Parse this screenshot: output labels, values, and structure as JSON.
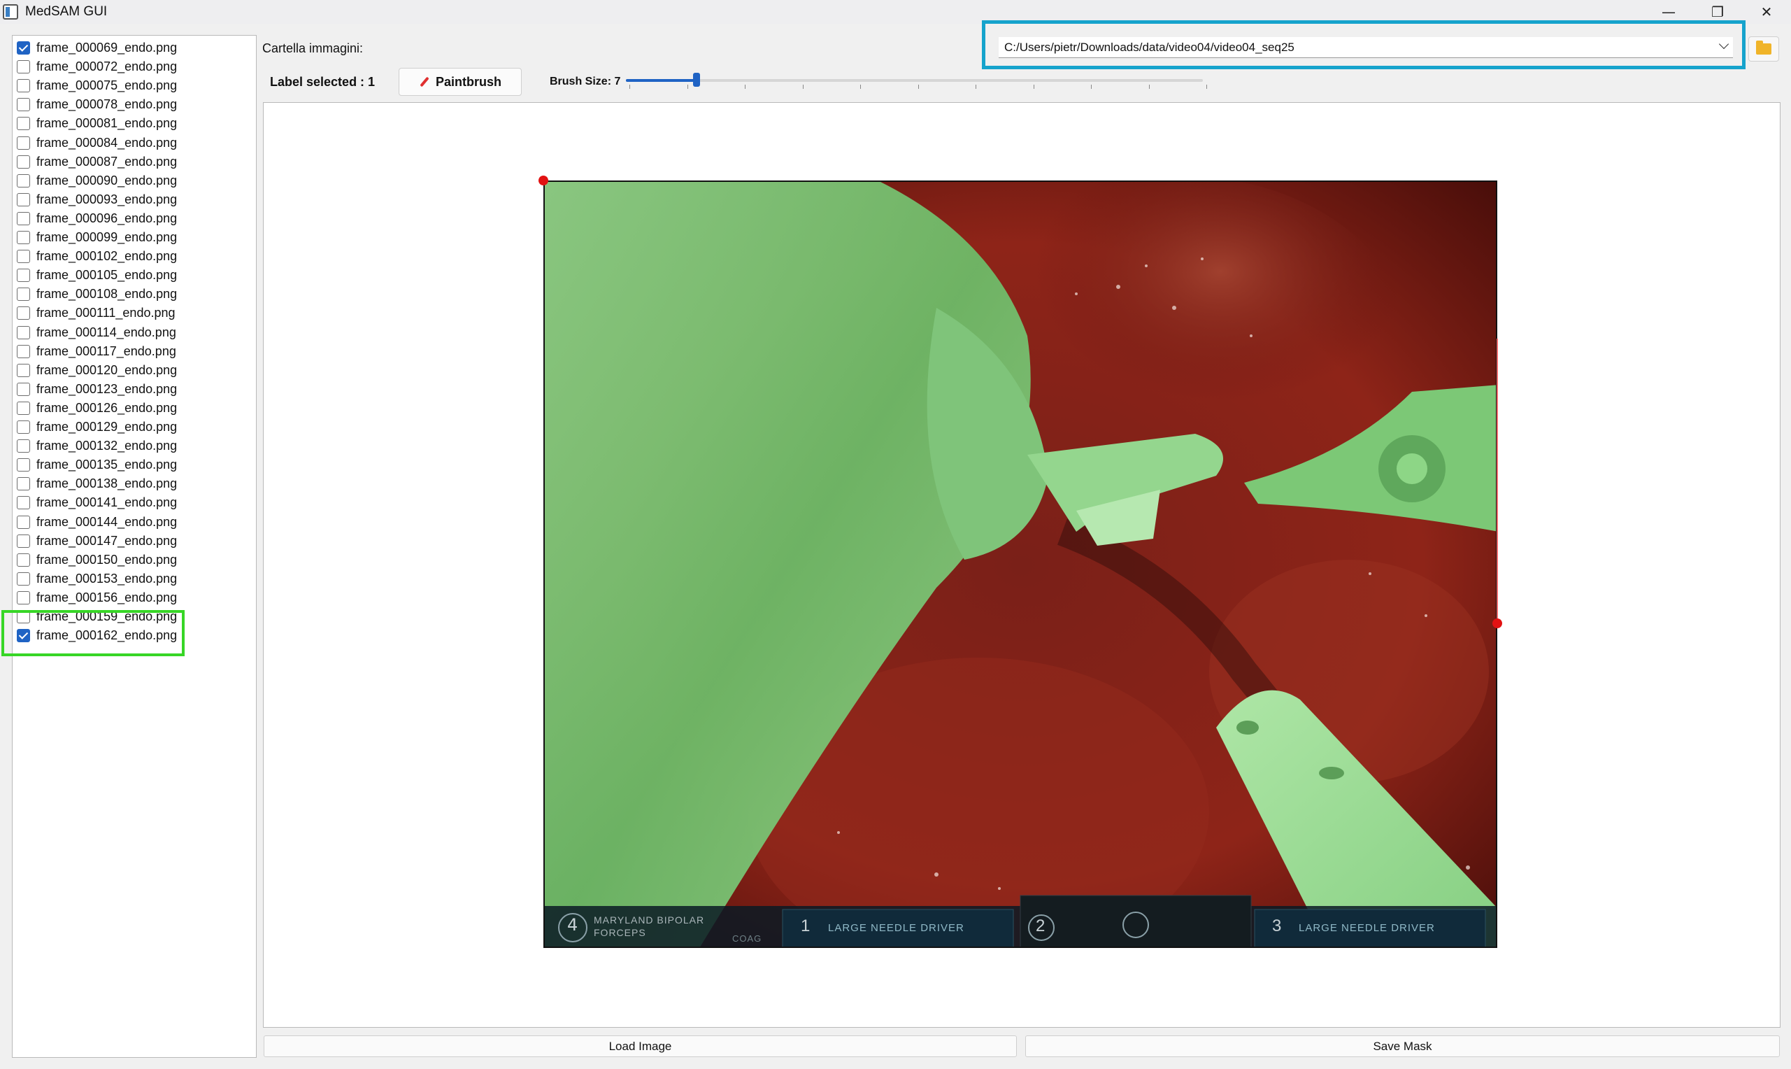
{
  "window": {
    "title": "MedSAM GUI",
    "controls": {
      "minimize": "—",
      "restore": "❐",
      "close": "✕"
    }
  },
  "files": [
    {
      "name": "frame_000069_endo.png",
      "checked": true
    },
    {
      "name": "frame_000072_endo.png",
      "checked": false
    },
    {
      "name": "frame_000075_endo.png",
      "checked": false
    },
    {
      "name": "frame_000078_endo.png",
      "checked": false
    },
    {
      "name": "frame_000081_endo.png",
      "checked": false
    },
    {
      "name": "frame_000084_endo.png",
      "checked": false
    },
    {
      "name": "frame_000087_endo.png",
      "checked": false
    },
    {
      "name": "frame_000090_endo.png",
      "checked": false
    },
    {
      "name": "frame_000093_endo.png",
      "checked": false
    },
    {
      "name": "frame_000096_endo.png",
      "checked": false
    },
    {
      "name": "frame_000099_endo.png",
      "checked": false
    },
    {
      "name": "frame_000102_endo.png",
      "checked": false
    },
    {
      "name": "frame_000105_endo.png",
      "checked": false
    },
    {
      "name": "frame_000108_endo.png",
      "checked": false
    },
    {
      "name": "frame_000111_endo.png",
      "checked": false
    },
    {
      "name": "frame_000114_endo.png",
      "checked": false
    },
    {
      "name": "frame_000117_endo.png",
      "checked": false
    },
    {
      "name": "frame_000120_endo.png",
      "checked": false
    },
    {
      "name": "frame_000123_endo.png",
      "checked": false
    },
    {
      "name": "frame_000126_endo.png",
      "checked": false
    },
    {
      "name": "frame_000129_endo.png",
      "checked": false
    },
    {
      "name": "frame_000132_endo.png",
      "checked": false
    },
    {
      "name": "frame_000135_endo.png",
      "checked": false
    },
    {
      "name": "frame_000138_endo.png",
      "checked": false
    },
    {
      "name": "frame_000141_endo.png",
      "checked": false
    },
    {
      "name": "frame_000144_endo.png",
      "checked": false
    },
    {
      "name": "frame_000147_endo.png",
      "checked": false
    },
    {
      "name": "frame_000150_endo.png",
      "checked": false
    },
    {
      "name": "frame_000153_endo.png",
      "checked": false
    },
    {
      "name": "frame_000156_endo.png",
      "checked": false
    },
    {
      "name": "frame_000159_endo.png",
      "checked": false
    },
    {
      "name": "frame_000162_endo.png",
      "checked": true
    }
  ],
  "folder": {
    "label": "Cartella immagini:",
    "path": "C:/Users/pietr/Downloads/data/video04/video04_seq25",
    "browse_icon": "folder-icon"
  },
  "toolbar": {
    "label_selected": "Label selected : 1",
    "paintbrush": "Paintbrush",
    "brush_size_label": "Brush Size: 7",
    "brush_size": 7,
    "brush_min": 1,
    "brush_max": 50
  },
  "overlay": {
    "instrument_1": "MARYLAND BIPOLAR FORCEPS",
    "instrument_1_num": "4",
    "instrument_1_mode": "COAG",
    "instrument_2": "LARGE NEEDLE DRIVER",
    "instrument_2_num": "1",
    "center_num": "2",
    "instrument_3": "LARGE NEEDLE DRIVER",
    "instrument_3_num": "3"
  },
  "buttons": {
    "load_image": "Load Image",
    "save_mask": "Save Mask"
  },
  "colors": {
    "mask": "#8ed88a",
    "tissue": "#8a1c14",
    "highlight_folder": "#16a3cc",
    "highlight_item": "#37d626",
    "accent": "#1f63c4"
  }
}
